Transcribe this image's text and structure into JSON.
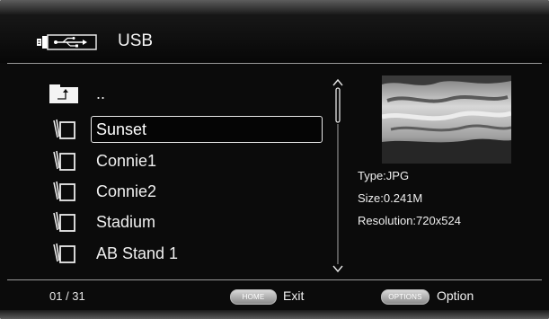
{
  "header": {
    "title": "USB",
    "source_icon": "usb-icon"
  },
  "file_list": {
    "items": [
      {
        "label": "..",
        "icon": "parent-folder-icon",
        "selected": false
      },
      {
        "label": "Sunset",
        "icon": "photos-stack-icon",
        "selected": true
      },
      {
        "label": "Connie1",
        "icon": "photos-stack-icon",
        "selected": false
      },
      {
        "label": "Connie2",
        "icon": "photos-stack-icon",
        "selected": false
      },
      {
        "label": "Stadium",
        "icon": "photos-stack-icon",
        "selected": false
      },
      {
        "label": "AB Stand 1",
        "icon": "photos-stack-icon",
        "selected": false
      }
    ]
  },
  "file_info": {
    "type": "Type:JPG",
    "size": "Size:0.241M",
    "resolution": "Resolution:720x524",
    "preview_icon": "sunset-clouds-thumbnail"
  },
  "footer": {
    "page_count": "01 / 31",
    "home_button": "HOME",
    "home_label": "Exit",
    "options_button": "OPTIONS",
    "options_label": "Option"
  },
  "colors": {
    "background": "#0b0b0b",
    "text": "#f0f0f0",
    "divider": "#9a9a9a",
    "selection_border": "#e8e8e8"
  }
}
